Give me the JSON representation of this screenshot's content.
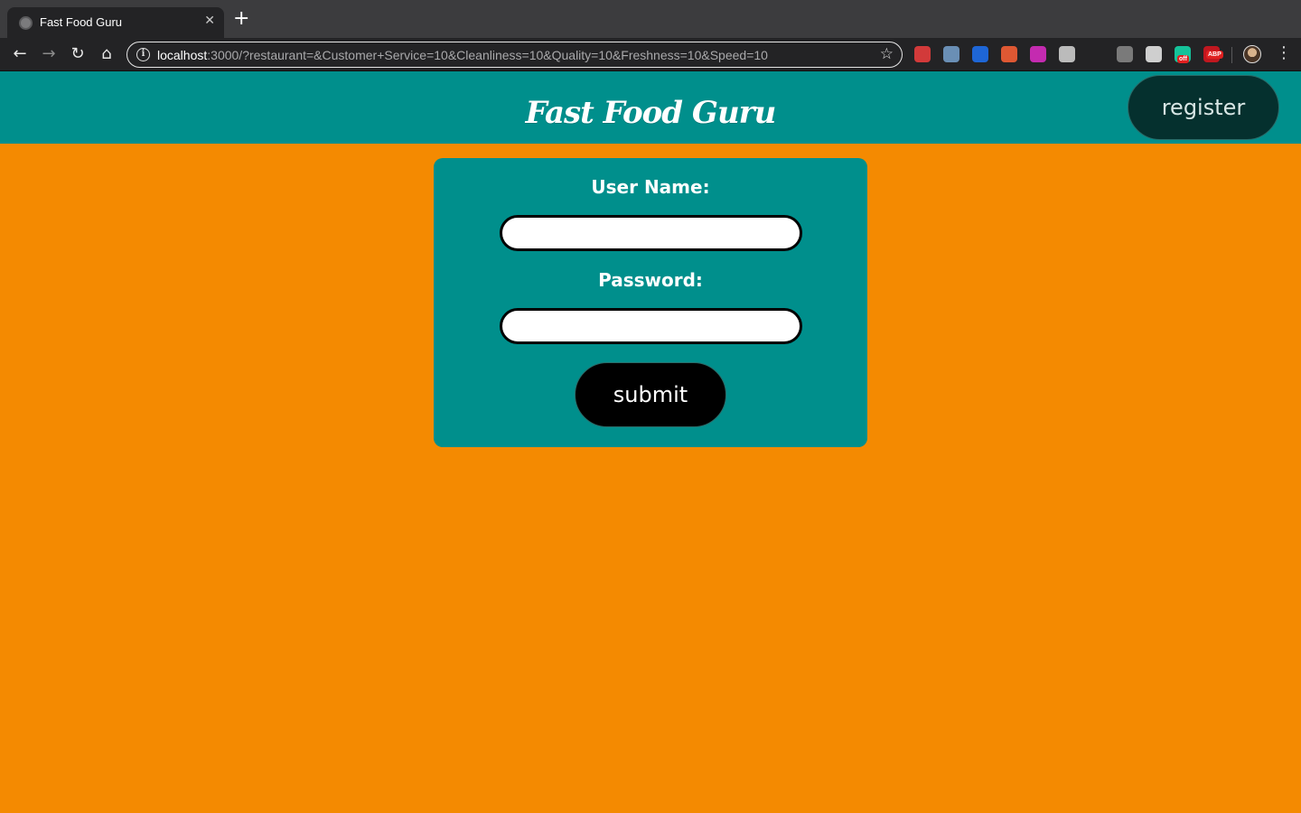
{
  "browser": {
    "tab": {
      "title": "Fast Food Guru",
      "close": "✕"
    },
    "new_tab": "+",
    "nav": {
      "back": "←",
      "forward": "→",
      "reload": "↻",
      "home": "⌂"
    },
    "address": {
      "host": "localhost",
      "rest": ":3000/?restaurant=&Customer+Service=10&Cleanliness=10&Quality=10&Freshness=10&Speed=10"
    },
    "info": "i",
    "bookmark": "☆",
    "menu": "⋮",
    "extensions": [
      {
        "name": "extension-1",
        "color": "#d23a3a"
      },
      {
        "name": "extension-2",
        "color": "#6a8fb5"
      },
      {
        "name": "extension-3",
        "color": "#1e66d6"
      },
      {
        "name": "duckduckgo-extension",
        "color": "#de5833"
      },
      {
        "name": "dark-mode-extension",
        "color": "#c42bb0"
      },
      {
        "name": "pen-extension",
        "color": "#bbbbbb"
      },
      {
        "name": "extension-7",
        "color": "#7a7a7a"
      },
      {
        "name": "extension-8",
        "color": "#cfcfcf"
      },
      {
        "name": "grammarly-extension",
        "color": "#15c39a",
        "badge": "off"
      },
      {
        "name": "adblock-extension",
        "color": "#c0171f",
        "badge": "ABP"
      }
    ]
  },
  "header": {
    "brand": "Fast Food Guru",
    "register_label": "register"
  },
  "form": {
    "username_label": "User Name:",
    "username_value": "",
    "password_label": "Password:",
    "password_value": "",
    "submit_label": "submit"
  },
  "colors": {
    "page_background": "#f48a01",
    "header_background": "#008f8c",
    "card_background": "#008f8c",
    "register_background": "#05302e",
    "submit_background": "#000000"
  }
}
